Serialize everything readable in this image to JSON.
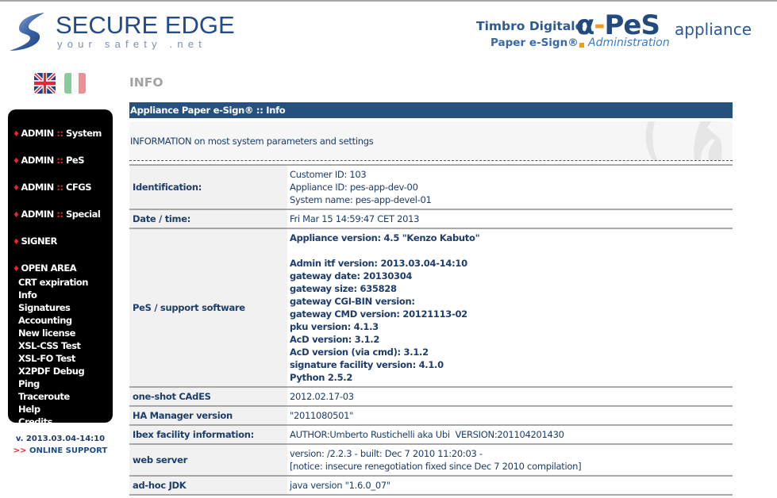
{
  "header": {
    "brand_title": "SECURE EDGE",
    "brand_subtitle": "your safety .net",
    "product_prefix": "Timbro Digitale",
    "product_alpha": "α",
    "product_dash": "-",
    "product_name": "PeS",
    "product_suffix": "appliance",
    "product_line": "Paper e-Sign®",
    "product_section": "Administration",
    "accent_color": "#f29a1f",
    "brand_color": "#234a8a"
  },
  "languages": [
    {
      "code": "en",
      "icon": "uk-flag-icon"
    },
    {
      "code": "it",
      "icon": "italy-flag-icon"
    }
  ],
  "sidebar": {
    "groups": [
      {
        "prefix": "ADMIN",
        "sep": "::",
        "label": "System"
      },
      {
        "prefix": "ADMIN",
        "sep": "::",
        "label": "PeS"
      },
      {
        "prefix": "ADMIN",
        "sep": "::",
        "label": "CFGS"
      },
      {
        "prefix": "ADMIN",
        "sep": "::",
        "label": "Special"
      }
    ],
    "signer": "SIGNER",
    "open_area": "OPEN AREA",
    "open_area_items": [
      "CRT expiration",
      "Info",
      "Signatures",
      "Accounting",
      "New license",
      "XSL-CSS Test",
      "XSL-FO Test",
      "X2PDF Debug",
      "Ping",
      "Traceroute",
      "Help",
      "Credits"
    ],
    "version": "v. 2013.03.04-14:10",
    "support_arrow": ">>",
    "support_label": "ONLINE SUPPORT"
  },
  "main": {
    "page_title": "INFO",
    "panel_title": "Appliance Paper e-Sign® :: Info",
    "panel_description": "INFORMATION on most system parameters and settings",
    "rows": {
      "identification": {
        "label": "Identification:",
        "lines": [
          "Customer ID: 103",
          "Appliance ID: pes-app-dev-00",
          "System name: pes-app-devel-01"
        ]
      },
      "datetime": {
        "label": "Date / time:",
        "value": "Fri Mar 15 14:59:47 CET 2013"
      },
      "pes_software": {
        "label": "PeS / support software",
        "appliance_version": "Appliance version: 4.5 \"Kenzo Kabuto\"",
        "lines": [
          "Admin itf version: 2013.03.04-14:10",
          "gateway date: 20130304",
          "gateway size: 635828",
          "gateway CGI-BIN version:",
          "gateway CMD version: 20121113-02",
          "pku version: 4.1.3",
          "AcD version: 3.1.2",
          "AcD version (via cmd): 3.1.2",
          "signature facility version: 4.1.0",
          "Python 2.5.2"
        ]
      },
      "cades": {
        "label": "one-shot CAdES",
        "value": "2012.02.17-03"
      },
      "ha_manager": {
        "label": "HA Manager version",
        "value": "\"2011080501\""
      },
      "ibex": {
        "label": "Ibex facility information:",
        "value": "AUTHOR:Umberto Rustichelli aka Ubi  VERSION:201104201430"
      },
      "web_server": {
        "label": "web server",
        "lines": [
          "version: /2.2.3 - built: Dec 7 2010 11:20:03 -",
          "[notice: insecure renegotiation fixed since Dec 7 2010 compilation]"
        ]
      },
      "jdk": {
        "label": "ad-hoc JDK",
        "value": "java version \"1.6.0_07\""
      }
    }
  }
}
